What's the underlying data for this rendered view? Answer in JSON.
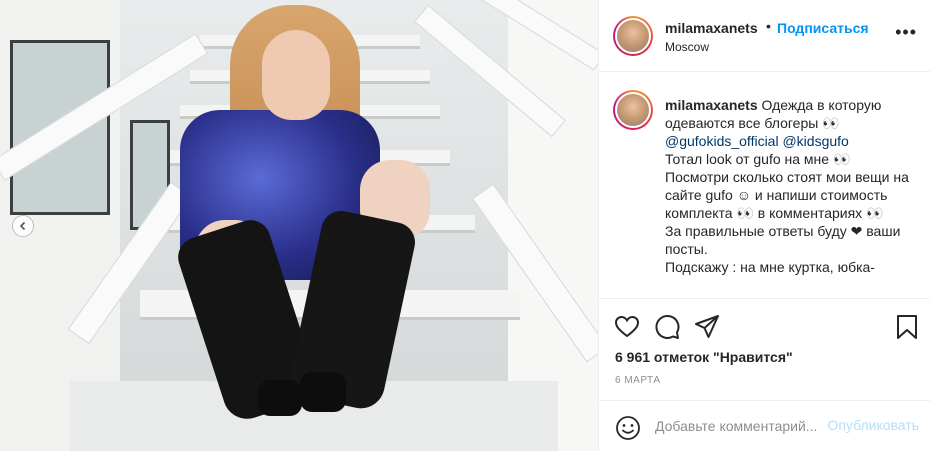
{
  "post": {
    "author": "milamaxanets",
    "dot": "•",
    "follow_label": "Подписаться",
    "location": "Moscow",
    "more_label": "•••"
  },
  "caption": {
    "author": "milamaxanets",
    "line1": " Одежда в которую одеваются все блогеры ",
    "emoji1": "👀",
    "tag1": "@gufokids_official",
    "tag2": "@kidsgufo",
    "line2": "Тотал look от gufo на мне ",
    "emoji2": "👀",
    "line3": "Посмотри сколько стоят мои вещи на сайте gufo ",
    "emoji3": "☺",
    "line3b": " и напиши стоимость комплекта ",
    "emoji4": "👀",
    "line3c": " в комментариях ",
    "emoji5": "👀",
    "line4": "За правильные ответы буду ",
    "heart": "❤",
    "line4b": " ваши посты.",
    "line5": "Подскажу : на мне куртка, юбка-"
  },
  "likes_text": "6 961 отметок \"Нравится\"",
  "date_text": "6 МАРТА",
  "comment": {
    "placeholder": "Добавьте комментарий...",
    "post_label": "Опубликовать"
  },
  "icons": {
    "carousel_prev": "chevron-left-icon",
    "like": "heart-icon",
    "comment": "comment-icon",
    "share": "share-icon",
    "save": "bookmark-icon",
    "emoji": "emoji-icon"
  }
}
